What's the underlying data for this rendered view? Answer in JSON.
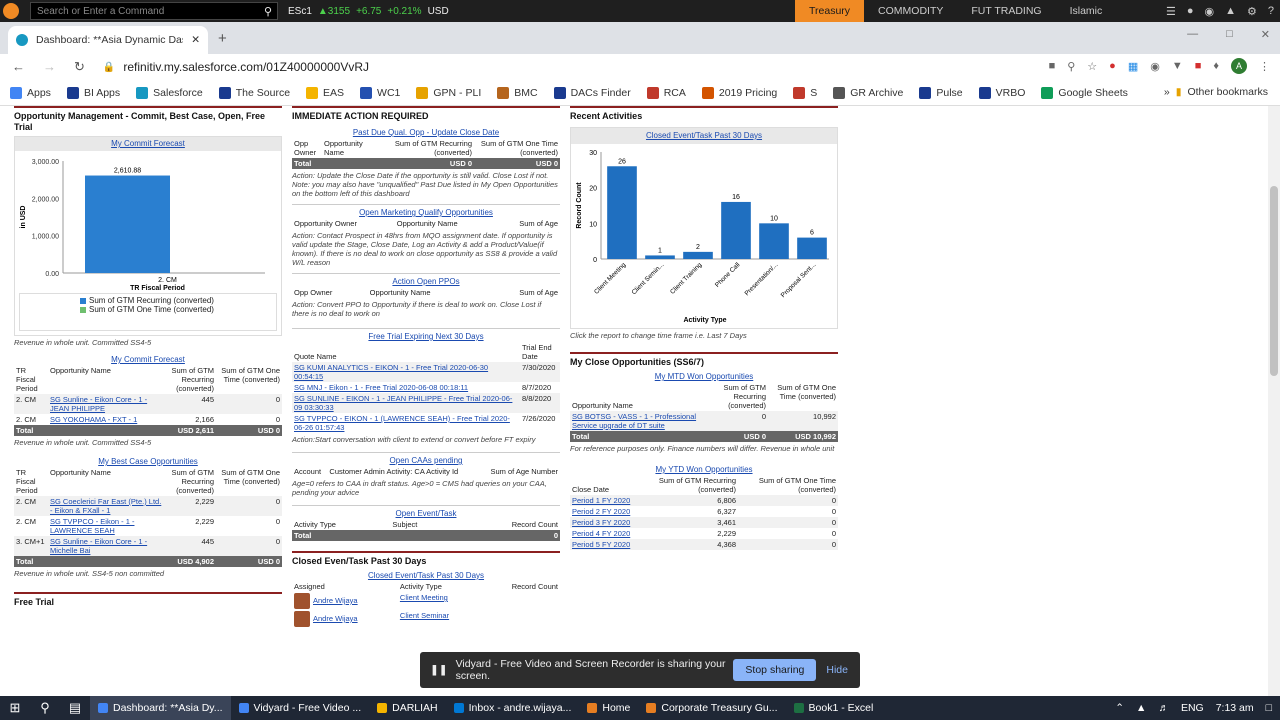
{
  "eikon": {
    "search_placeholder": "Search or Enter a Command",
    "ric": "ESc1",
    "quote": "▲3155",
    "chg": "+6.75",
    "pct": "+0.21%",
    "ccy": "USD",
    "tabs": [
      "Treasury",
      "COMMODITY",
      "FUT TRADING",
      "Islamic"
    ]
  },
  "browser": {
    "tab_title": "Dashboard: **Asia Dynamic Dash",
    "url": "refinitiv.my.salesforce.com/01Z40000000VvRJ",
    "avatar": "A",
    "bookmarks": [
      "Apps",
      "BI Apps",
      "Salesforce",
      "The Source",
      "EAS",
      "WC1",
      "GPN - PLI",
      "BMC",
      "DACs Finder",
      "RCA",
      "2019 Pricing",
      "S",
      "GR Archive",
      "Pulse",
      "VRBO",
      "Google Sheets"
    ],
    "bookmark_colors": [
      "#4285f4",
      "#1a3a8f",
      "#1798c1",
      "#1a3a8f",
      "#f4b400",
      "#2450b0",
      "#e6a200",
      "#b5651d",
      "#1a3a8f",
      "#c0392b",
      "#d35400",
      "#c0392b",
      "#555",
      "#1a3a8f",
      "#1a3a8f",
      "#0f9d58"
    ],
    "more": "»",
    "other_bookmarks": "Other bookmarks"
  },
  "col1": {
    "title": "Opportunity Management - Commit, Best Case, Open, Free Trial",
    "chart_title": "My Commit Forecast",
    "chart_data": {
      "type": "bar",
      "categories": [
        "2. CM"
      ],
      "series": [
        {
          "name": "Sum of GTM Recurring (converted)",
          "values": [
            2610.88
          ]
        }
      ],
      "ylim": [
        0,
        3000
      ],
      "yticks": [
        "0.00",
        "1,000.00",
        "2,000.00",
        "3,000.00"
      ],
      "value_label": "2,610.88",
      "ylabel": "in USD",
      "xlabel": "TR Fiscal Period",
      "legend": [
        "Sum of GTM Recurring (converted)",
        "Sum of GTM One Time (converted)"
      ],
      "legend_colors": [
        "#2a7fd0",
        "#6fbf6f"
      ]
    },
    "note1": "Revenue in whole unit. Committed SS4-5",
    "commit_link": "My Commit Forecast",
    "commit_headers": [
      "TR Fiscal Period",
      "Opportunity Name",
      "Sum of GTM Recurring (converted)",
      "Sum of GTM One Time (converted)"
    ],
    "commit_rows": [
      [
        "2. CM",
        "SG Sunline - Eikon Core - 1 - JEAN PHILIPPE",
        "445",
        "0"
      ],
      [
        "2. CM",
        "SG YOKOHAMA - FXT - 1",
        "2,166",
        "0"
      ]
    ],
    "commit_total": [
      "Total",
      "",
      "USD 2,611",
      "USD 0"
    ],
    "note2": "Revenue in whole unit. Committed SS4-5",
    "best_link": "My Best Case Opportunities",
    "best_headers": [
      "TR Fiscal Period",
      "Opportunity Name",
      "Sum of GTM Recurring (converted)",
      "Sum of GTM One Time (converted)"
    ],
    "best_rows": [
      [
        "2. CM",
        "SG Coeclerici Far East (Pte.) Ltd. - Eikon & FXall - 1",
        "2,229",
        "0"
      ],
      [
        "2. CM",
        "SG TVPPCO - Eikon - 1 - LAWRENCE SEAH",
        "2,229",
        "0"
      ],
      [
        "3. CM+1",
        "SG Sunline - Eikon Core - 1 - Michelle Bai",
        "445",
        "0"
      ]
    ],
    "best_total": [
      "Total",
      "",
      "USD 4,902",
      "USD 0"
    ],
    "note3": "Revenue in whole unit. SS4-5 non committed",
    "free_trial": "Free Trial"
  },
  "col2": {
    "title": "IMMEDIATE ACTION REQUIRED",
    "past_due_link": "Past Due Qual. Opp - Update Close Date",
    "past_due_headers": [
      "Opp Owner",
      "Opportunity Name",
      "Sum of GTM Recurring (converted)",
      "Sum of GTM One Time (converted)"
    ],
    "past_due_total": [
      "Total",
      "",
      "USD 0",
      "USD 0"
    ],
    "past_due_note": "Action: Update the Close Date if the opportunity is still valid. Close Lost if not. Note: you may also have \"unqualified\" Past Due listed in My Open Opportunities on the bottom left of this dashboard",
    "mqo_link": "Open Marketing Qualify Opportunities",
    "mqo_headers": [
      "Opportunity Owner",
      "Opportunity Name",
      "Sum of Age"
    ],
    "mqo_note": "Action: Contact Prospect in 48hrs from MQO assignment date. If opportunity is valid update the Stage, Close Date, Log an Activity & add a Product/Value(if known). If there is no deal to work on close opportunity as SS8 & provide a valid W/L reason",
    "ppo_link": "Action Open PPOs",
    "ppo_headers": [
      "Opp Owner",
      "Opportunity Name",
      "Sum of Age"
    ],
    "ppo_note": "Action: Convert PPO to Opportunity if there is deal to work on. Close Lost if there is no deal to work on",
    "ft_link": "Free Trial Expiring Next 30 Days",
    "ft_headers": [
      "Quote Name",
      "Trial End Date"
    ],
    "ft_rows": [
      [
        "SG KUMI ANALYTICS - EIKON - 1 - Free Trial 2020-06-30 00:54:15",
        "7/30/2020"
      ],
      [
        "SG MNJ - Eikon - 1 - Free Trial 2020-06-08 00:18:11",
        "8/7/2020"
      ],
      [
        "SG SUNLINE - EIKON - 1 - JEAN PHILIPPE - Free Trial 2020-06-09 03:30:33",
        "8/8/2020"
      ],
      [
        "SG TVPPCO - EIKON - 1 (LAWRENCE SEAH) - Free Trial 2020-06-26 01:57:43",
        "7/26/2020"
      ]
    ],
    "ft_note": "Action:Start conversation with client to extend or convert before FT expiry",
    "caa_link": "Open CAAs pending",
    "caa_headers": [
      "Account",
      "Customer Admin Activity: CA Activity Id",
      "Sum of Age Number"
    ],
    "caa_note": "Age=0 refers to CAA in draft status. Age>0 = CMS had queries on your CAA, pending your advice",
    "task_link": "Open Event/Task",
    "task_headers": [
      "Activity Type",
      "Subject",
      "Record Count"
    ],
    "task_total": [
      "Total",
      "",
      "0"
    ],
    "closed_title": "Closed Even/Task Past 30 Days",
    "closed_link": "Closed Event/Task Past 30 Days",
    "closed_headers": [
      "Assigned",
      "Activity Type",
      "Record Count"
    ],
    "closed_rows": [
      [
        "Andre Wijaya",
        "Client Meeting",
        ""
      ],
      [
        "Andre Wijaya",
        "Client Seminar",
        ""
      ]
    ]
  },
  "col3": {
    "title": "Recent Activities",
    "chart_title": "Closed Event/Task Past 30 Days",
    "chart_data": {
      "type": "bar",
      "categories": [
        "Client Meeting",
        "Client Semin...",
        "Client Training",
        "Phone Call",
        "Presentation/...",
        "Proposal Sent..."
      ],
      "values": [
        26,
        1,
        2,
        16,
        10,
        6
      ],
      "ylim": [
        0,
        30
      ],
      "yticks": [
        "0",
        "10",
        "20",
        "30"
      ],
      "ylabel": "Record Count",
      "xlabel": "Activity Type"
    },
    "note": "Click the report to change time frame i.e. Last 7 Days",
    "close_title": "My Close Opportunities (SS6/7)",
    "mtd_link": "My MTD Won Opportunities",
    "mtd_headers": [
      "Opportunity Name",
      "Sum of GTM Recurring (converted)",
      "Sum of GTM One Time (converted)"
    ],
    "mtd_rows": [
      [
        "SG BOTSG - VASS - 1 - Professional Service upgrade of DT suite",
        "0",
        "10,992"
      ]
    ],
    "mtd_total": [
      "Total",
      "USD 0",
      "USD 10,992"
    ],
    "mtd_note": "For reference purposes only. Finance numbers will differ. Revenue in whole unit",
    "ytd_link": "My YTD Won Opportunities",
    "ytd_headers": [
      "Close Date",
      "Sum of GTM Recurring (converted)",
      "Sum of GTM One Time (converted)"
    ],
    "ytd_rows": [
      [
        "Period 1 FY 2020",
        "6,806",
        "0"
      ],
      [
        "Period 2 FY 2020",
        "6,327",
        "0"
      ],
      [
        "Period 3 FY 2020",
        "3,461",
        "0"
      ],
      [
        "Period 4 FY 2020",
        "2,229",
        "0"
      ],
      [
        "Period 5 FY 2020",
        "4,368",
        "0"
      ]
    ]
  },
  "share": {
    "msg": "Vidyard - Free Video and Screen Recorder is sharing your screen.",
    "stop": "Stop sharing",
    "hide": "Hide"
  },
  "taskbar": {
    "items": [
      "Dashboard: **Asia Dy...",
      "Vidyard - Free Video ...",
      "DARLIAH",
      "Inbox - andre.wijaya...",
      "Home",
      "Corporate Treasury Gu...",
      "Book1 - Excel"
    ],
    "colors": [
      "#4285f4",
      "#4285f4",
      "#f4b400",
      "#0078d4",
      "#e67e22",
      "#e67e22",
      "#1d6f42"
    ],
    "lang": "ENG",
    "time": "7:13 am"
  }
}
